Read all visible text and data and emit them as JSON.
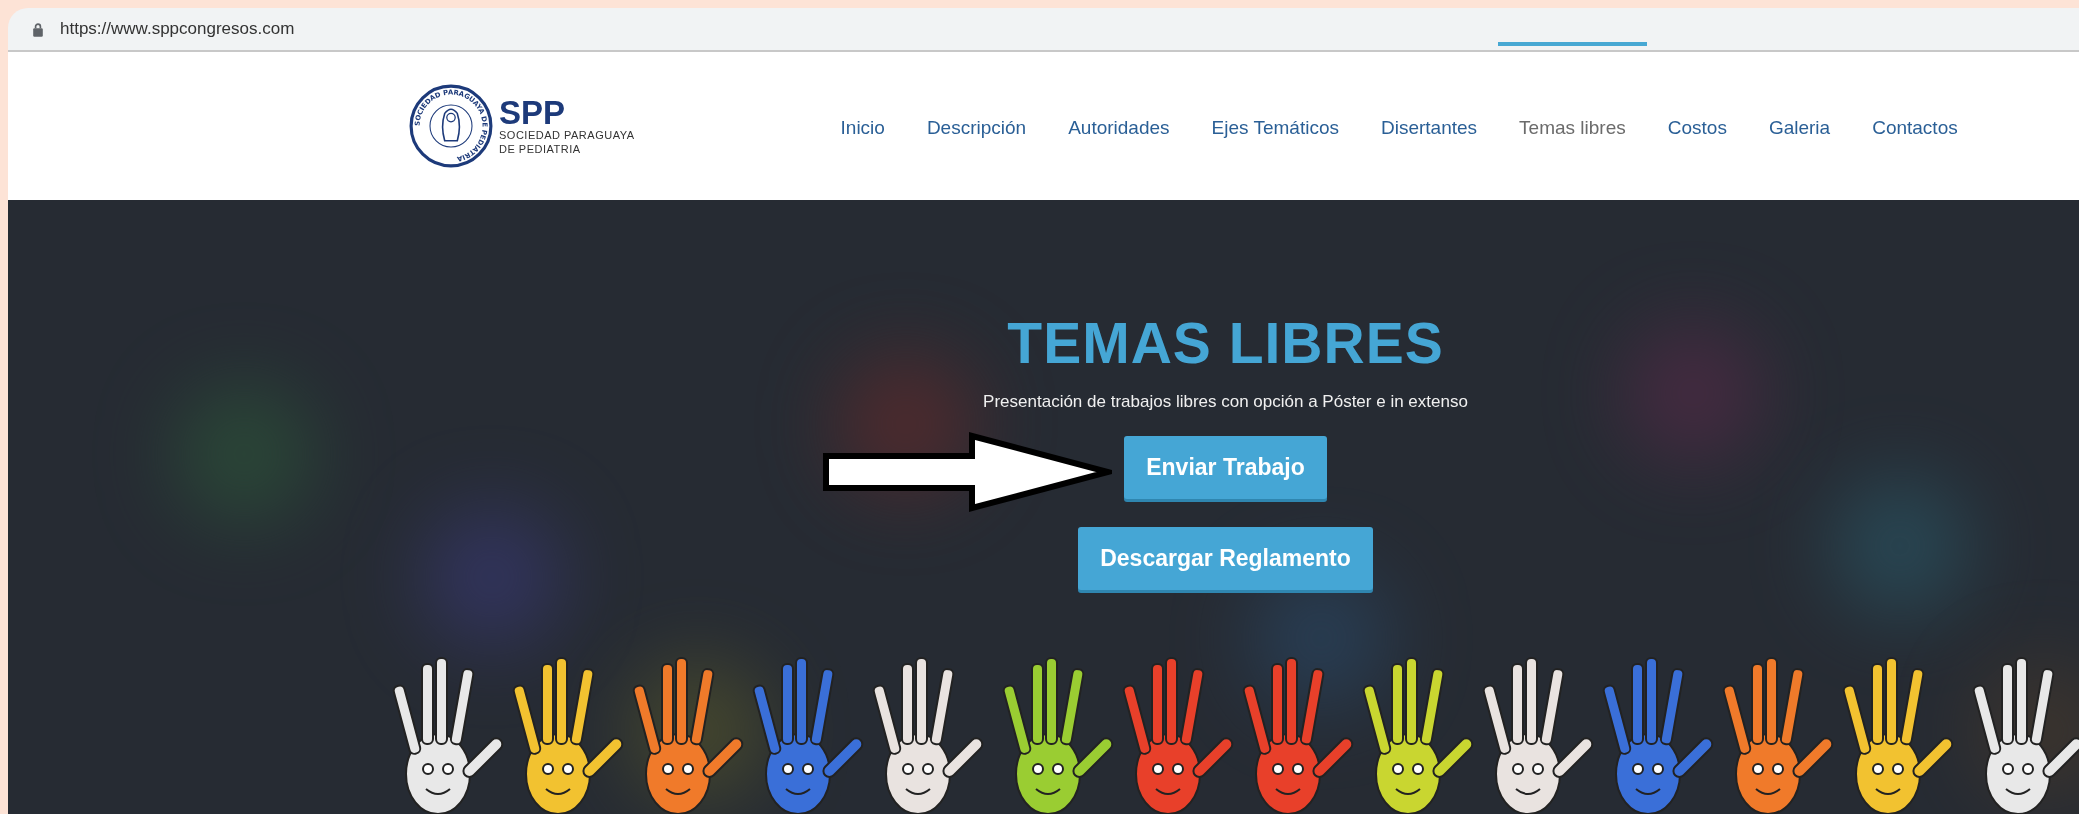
{
  "browser": {
    "url": "https://www.sppcongresos.com"
  },
  "logo": {
    "acronym": "SPP",
    "name_line_1": "SOCIEDAD PARAGUAYA",
    "name_line_2": "DE PEDIATRIA",
    "seal_text": "SOCIEDAD PARAGUAYA DE PEDIATRIA"
  },
  "nav": [
    {
      "label": "Inicio",
      "selected": false
    },
    {
      "label": "Descripción",
      "selected": false
    },
    {
      "label": "Autoridades",
      "selected": false
    },
    {
      "label": "Ejes Temáticos",
      "selected": false
    },
    {
      "label": "Disertantes",
      "selected": false
    },
    {
      "label": "Temas libres",
      "selected": true
    },
    {
      "label": "Costos",
      "selected": false
    },
    {
      "label": "Galeria",
      "selected": false
    },
    {
      "label": "Contactos",
      "selected": false
    }
  ],
  "hero": {
    "title": "TEMAS LIBRES",
    "subtitle": "Presentación de trabajos libres con opción a Póster e in extenso",
    "buttons": [
      {
        "label": "Enviar Trabajo",
        "kind": "pointed"
      },
      {
        "label": "Descargar Reglamento",
        "kind": "plain"
      }
    ]
  }
}
